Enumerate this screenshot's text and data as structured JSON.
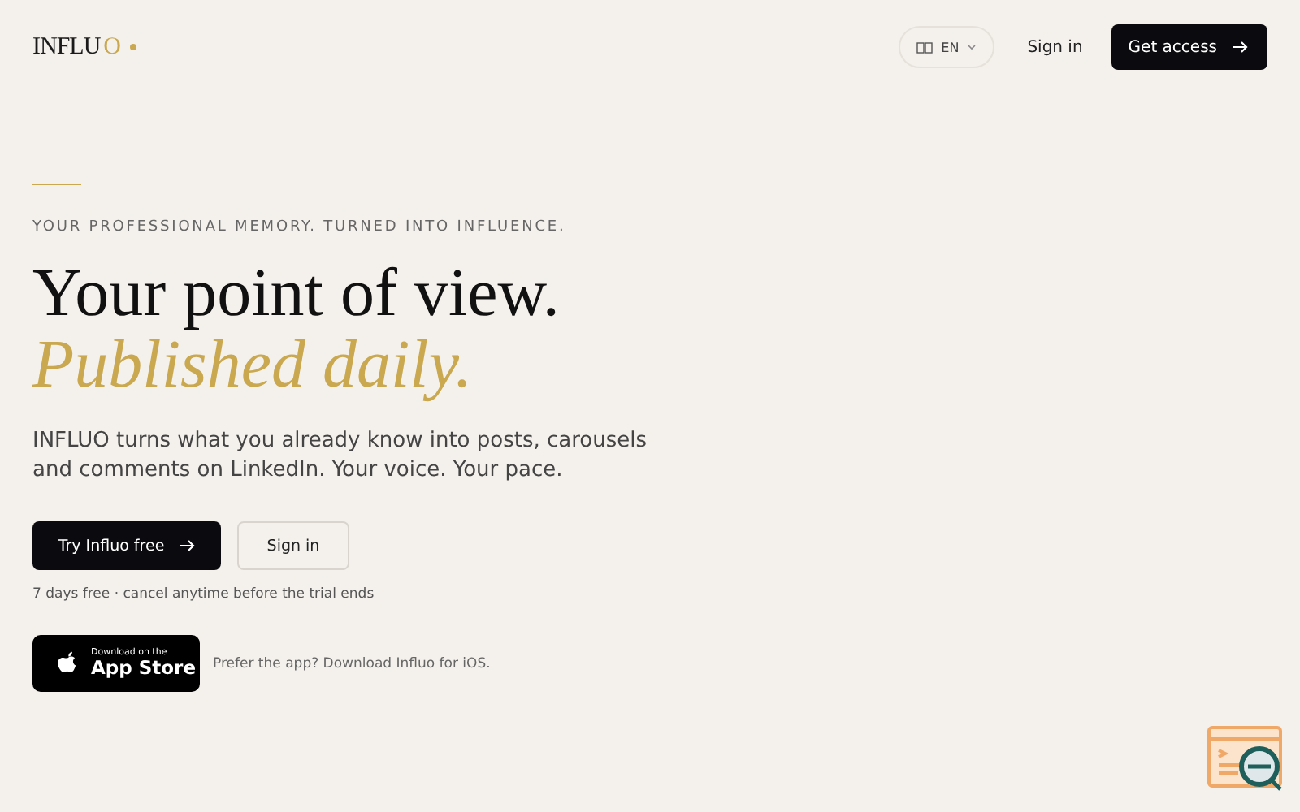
{
  "header": {
    "logo": {
      "text": "INFLU",
      "accent": "O"
    },
    "language": "EN",
    "sign_in": "Sign in",
    "cta": "Get access"
  },
  "hero": {
    "eyebrow": "YOUR PROFESSIONAL MEMORY. TURNED INTO INFLUENCE.",
    "title": "Your point of view.",
    "title_accent": "Published daily.",
    "description": "INFLUO turns what you already know into posts, carousels and comments on LinkedIn. Your voice. Your pace.",
    "primary_button": "Try Influo free",
    "secondary_button": "Sign in",
    "trial_note": "7 days free · cancel anytime before the trial ends"
  },
  "app_store": {
    "small": "Download on the",
    "large": "App Store",
    "note": "Prefer the app? Download Influo for iOS."
  }
}
